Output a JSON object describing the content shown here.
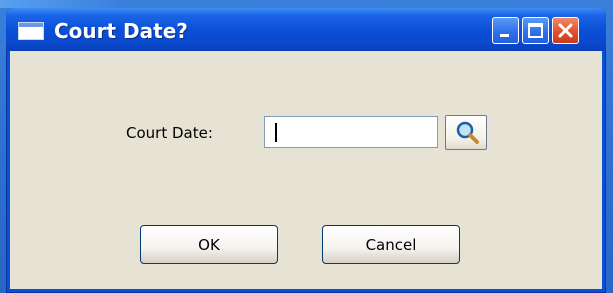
{
  "window": {
    "title": "Court Date?",
    "icon": "window-icon",
    "controls": [
      "minimize-icon",
      "maximize-icon",
      "close-icon"
    ]
  },
  "form": {
    "court_date_label": "Court Date:",
    "court_date_value": "",
    "lookup_icon": "magnifier-icon"
  },
  "buttons": {
    "ok_label": "OK",
    "cancel_label": "Cancel"
  },
  "colors": {
    "titlebar": "#0a50d8",
    "close_button": "#e0512e",
    "dialog_background": "#e7e3d4"
  }
}
